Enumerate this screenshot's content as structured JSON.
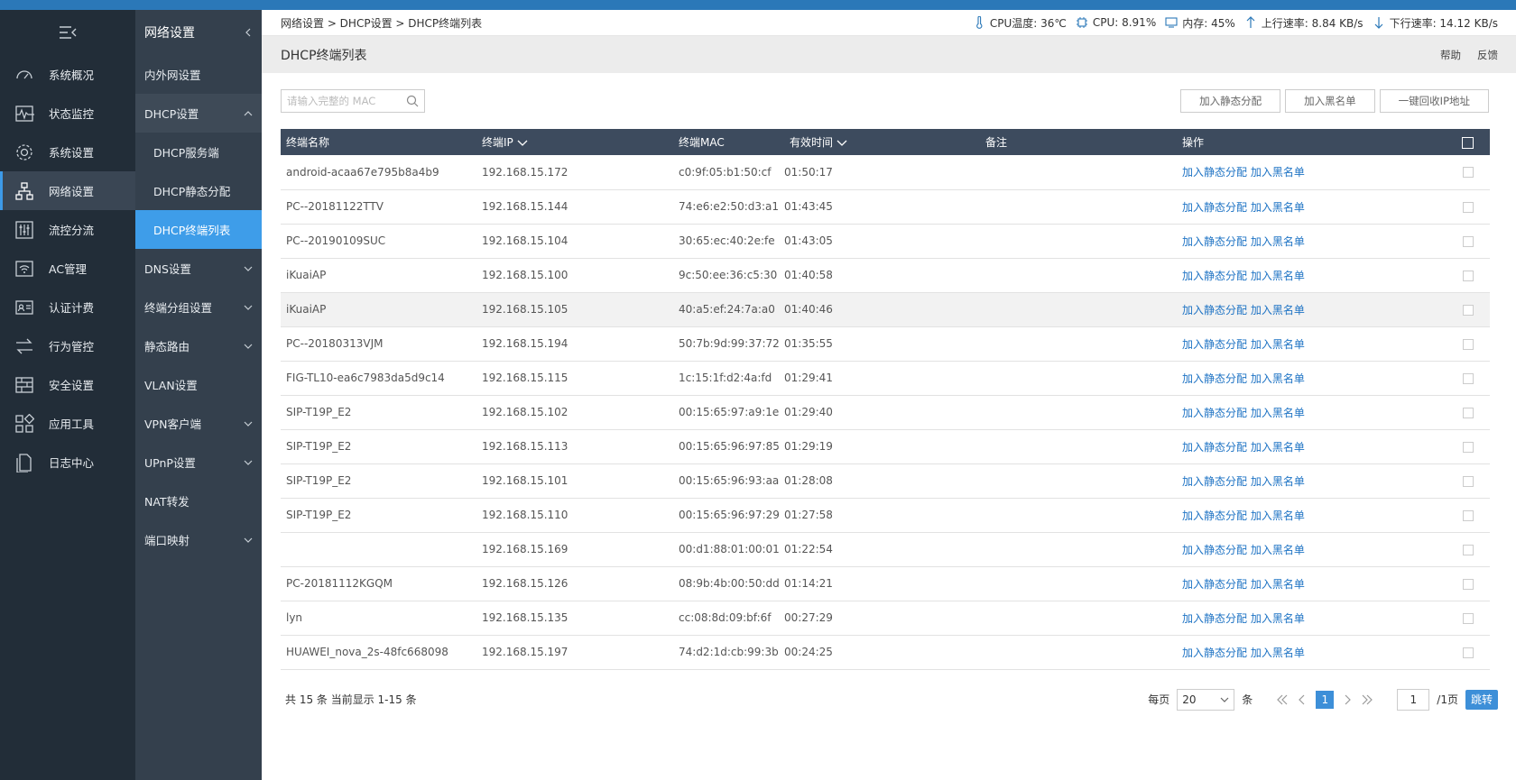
{
  "nav_primary": [
    {
      "label": "系统概况",
      "icon": "dashboard-icon"
    },
    {
      "label": "状态监控",
      "icon": "monitor-icon"
    },
    {
      "label": "系统设置",
      "icon": "gear-icon"
    },
    {
      "label": "网络设置",
      "icon": "network-icon",
      "active": true
    },
    {
      "label": "流控分流",
      "icon": "sliders-icon"
    },
    {
      "label": "AC管理",
      "icon": "wifi-icon"
    },
    {
      "label": "认证计费",
      "icon": "id-card-icon"
    },
    {
      "label": "行为管控",
      "icon": "arrows-icon"
    },
    {
      "label": "安全设置",
      "icon": "firewall-icon"
    },
    {
      "label": "应用工具",
      "icon": "apps-icon"
    },
    {
      "label": "日志中心",
      "icon": "document-icon"
    }
  ],
  "nav_secondary": {
    "header": "网络设置",
    "items": [
      {
        "label": "内外网设置"
      },
      {
        "label": "DHCP设置",
        "open": true
      },
      {
        "label": "DHCP服务端",
        "sub": true
      },
      {
        "label": "DHCP静态分配",
        "sub": true
      },
      {
        "label": "DHCP终端列表",
        "sub": true,
        "active": true
      },
      {
        "label": "DNS设置",
        "chevron": true
      },
      {
        "label": "终端分组设置",
        "chevron": true
      },
      {
        "label": "静态路由",
        "chevron": true
      },
      {
        "label": "VLAN设置"
      },
      {
        "label": "VPN客户端",
        "chevron": true
      },
      {
        "label": "UPnP设置",
        "chevron": true
      },
      {
        "label": "NAT转发"
      },
      {
        "label": "端口映射",
        "chevron": true
      }
    ]
  },
  "breadcrumb": "网络设置 > DHCP设置 > DHCP终端列表",
  "stats": {
    "cpu_temp": "CPU温度: 36℃",
    "cpu": "CPU: 8.91%",
    "memory": "内存: 45%",
    "upload": "上行速率: 8.84 KB/s",
    "download": "下行速率: 14.12 KB/s"
  },
  "page_title": "DHCP终端列表",
  "title_links": {
    "help": "帮助",
    "feedback": "反馈"
  },
  "search": {
    "placeholder": "请输入完整的 MAC"
  },
  "toolbar": {
    "static": "加入静态分配",
    "blacklist": "加入黑名单",
    "reclaim": "一键回收IP地址"
  },
  "table": {
    "headers": {
      "name": "终端名称",
      "ip": "终端IP",
      "mac": "终端MAC",
      "time": "有效时间",
      "note": "备注",
      "action": "操作"
    },
    "action_static": "加入静态分配",
    "action_blacklist": "加入黑名单",
    "rows": [
      {
        "name": "android-acaa67e795b8a4b9",
        "ip": "192.168.15.172",
        "mac": "c0:9f:05:b1:50:cf",
        "time": "01:50:17"
      },
      {
        "name": "PC--20181122TTV",
        "ip": "192.168.15.144",
        "mac": "74:e6:e2:50:d3:a1",
        "time": "01:43:45"
      },
      {
        "name": "PC--20190109SUC",
        "ip": "192.168.15.104",
        "mac": "30:65:ec:40:2e:fe",
        "time": "01:43:05"
      },
      {
        "name": "iKuaiAP",
        "ip": "192.168.15.100",
        "mac": "9c:50:ee:36:c5:30",
        "time": "01:40:58"
      },
      {
        "name": "iKuaiAP",
        "ip": "192.168.15.105",
        "mac": "40:a5:ef:24:7a:a0",
        "time": "01:40:46",
        "hover": true
      },
      {
        "name": "PC--20180313VJM",
        "ip": "192.168.15.194",
        "mac": "50:7b:9d:99:37:72",
        "time": "01:35:55"
      },
      {
        "name": "FIG-TL10-ea6c7983da5d9c14",
        "ip": "192.168.15.115",
        "mac": "1c:15:1f:d2:4a:fd",
        "time": "01:29:41"
      },
      {
        "name": "SIP-T19P_E2",
        "ip": "192.168.15.102",
        "mac": "00:15:65:97:a9:1e",
        "time": "01:29:40"
      },
      {
        "name": "SIP-T19P_E2",
        "ip": "192.168.15.113",
        "mac": "00:15:65:96:97:85",
        "time": "01:29:19"
      },
      {
        "name": "SIP-T19P_E2",
        "ip": "192.168.15.101",
        "mac": "00:15:65:96:93:aa",
        "time": "01:28:08"
      },
      {
        "name": "SIP-T19P_E2",
        "ip": "192.168.15.110",
        "mac": "00:15:65:96:97:29",
        "time": "01:27:58"
      },
      {
        "name": "",
        "ip": "192.168.15.169",
        "mac": "00:d1:88:01:00:01",
        "time": "01:22:54"
      },
      {
        "name": "PC-20181112KGQM",
        "ip": "192.168.15.126",
        "mac": "08:9b:4b:00:50:dd",
        "time": "01:14:21"
      },
      {
        "name": "lyn",
        "ip": "192.168.15.135",
        "mac": "cc:08:8d:09:bf:6f",
        "time": "00:27:29"
      },
      {
        "name": "HUAWEI_nova_2s-48fc668098",
        "ip": "192.168.15.197",
        "mac": "74:d2:1d:cb:99:3b",
        "time": "00:24:25"
      }
    ]
  },
  "pager": {
    "total": "共 15 条 当前显示 1-15 条",
    "per_page_label": "每页",
    "per_page": "20",
    "unit": "条",
    "current": "1",
    "page_input": "1",
    "pages": "/1页",
    "jump": "跳转"
  },
  "colors": {
    "topbar": "#2b78b8",
    "nav1": "#222d38",
    "nav2": "#34404d",
    "active": "#3e9de9",
    "thead": "#3d4b5e",
    "link": "#1e73c4"
  }
}
